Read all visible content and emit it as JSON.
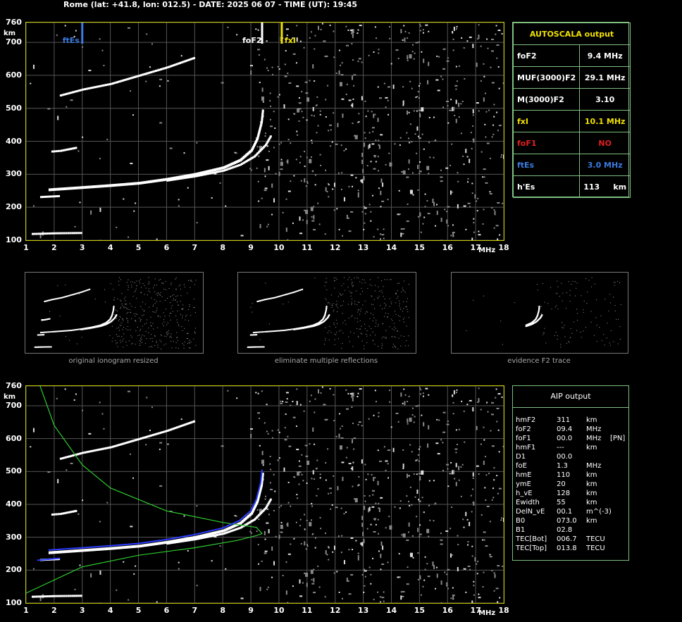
{
  "header": {
    "title": "Rome (lat: +41.8, lon: 012.5) - DATE: 2025 06 07 - TIME (UT): 19:45"
  },
  "axes": {
    "y_unit": "km",
    "x_unit": "MHz",
    "y_ticks": [
      "760",
      "700",
      "600",
      "500",
      "400",
      "300",
      "200",
      "100"
    ],
    "x_ticks": [
      "1",
      "2",
      "3",
      "4",
      "5",
      "6",
      "7",
      "8",
      "9",
      "10",
      "11",
      "12",
      "13",
      "14",
      "15",
      "16",
      "17",
      "18"
    ],
    "xlim": [
      1,
      18
    ],
    "ylim": [
      100,
      760
    ]
  },
  "markers": [
    {
      "label": "ftEs",
      "freq": 3.0,
      "color": "#3b7be0"
    },
    {
      "label": "foF2",
      "freq": 9.4,
      "color": "#ffffff"
    },
    {
      "label": "fxI",
      "freq": 10.1,
      "color": "#f0e000"
    }
  ],
  "autoscala": {
    "title": "AUTOSCALA output",
    "rows": [
      {
        "name": "foF2",
        "value": "9.4 MHz",
        "color": "#ffffff"
      },
      {
        "name": "MUF(3000)F2",
        "value": "29.1 MHz",
        "color": "#ffffff"
      },
      {
        "name": "M(3000)F2",
        "value": "3.10",
        "color": "#ffffff"
      },
      {
        "name": "fxI",
        "value": "10.1 MHz",
        "color": "#f0e000"
      },
      {
        "name": "foF1",
        "value": "NO",
        "color": "#e02020"
      },
      {
        "name": "ftEs",
        "value": "3.0 MHz",
        "color": "#3b7be0"
      },
      {
        "name": "h'Es",
        "value": "113     km",
        "color": "#ffffff"
      }
    ]
  },
  "thumbnails": [
    {
      "caption": "original ionogram resized"
    },
    {
      "caption": "eliminate multiple reflections"
    },
    {
      "caption": "evidence F2 trace"
    }
  ],
  "aip": {
    "title": "AIP output",
    "rows": [
      {
        "name": "hmF2",
        "value": "311",
        "unit": "km",
        "extra": ""
      },
      {
        "name": "foF2",
        "value": "09.4",
        "unit": "MHz",
        "extra": ""
      },
      {
        "name": "foF1",
        "value": "00.0",
        "unit": "MHz",
        "extra": "[PN]"
      },
      {
        "name": "hmF1",
        "value": "---",
        "unit": "km",
        "extra": ""
      },
      {
        "name": "D1",
        "value": "00.0",
        "unit": "",
        "extra": ""
      },
      {
        "name": "foE",
        "value": "1.3",
        "unit": "MHz",
        "extra": ""
      },
      {
        "name": "hmE",
        "value": "110",
        "unit": "km",
        "extra": ""
      },
      {
        "name": "ymE",
        "value": "20",
        "unit": "km",
        "extra": ""
      },
      {
        "name": "h_vE",
        "value": "128",
        "unit": "km",
        "extra": ""
      },
      {
        "name": "Ewidth",
        "value": "55",
        "unit": "km",
        "extra": ""
      },
      {
        "name": "DelN_vE",
        "value": "00.1",
        "unit": "m^(-3)",
        "extra": ""
      },
      {
        "name": "B0",
        "value": "073.0",
        "unit": "km",
        "extra": ""
      },
      {
        "name": "B1",
        "value": "02.8",
        "unit": "",
        "extra": ""
      },
      {
        "name": "TEC[Bot]",
        "value": "006.7",
        "unit": "TECU",
        "extra": ""
      },
      {
        "name": "TEC[Top]",
        "value": "013.8",
        "unit": "TECU",
        "extra": ""
      }
    ]
  },
  "chart_data": {
    "type": "scatter",
    "xlim": [
      1,
      18
    ],
    "ylim": [
      100,
      760
    ],
    "grid": true,
    "series": [
      {
        "values": [
          [
            1.2,
            120
          ],
          [
            2.0,
            122
          ],
          [
            3.0,
            123
          ]
        ]
      },
      {
        "values": [
          [
            1.5,
            232
          ],
          [
            2.2,
            235
          ]
        ]
      },
      {
        "values": [
          [
            1.8,
            255
          ],
          [
            3,
            262
          ],
          [
            4,
            268
          ],
          [
            5,
            275
          ],
          [
            6,
            287
          ],
          [
            7,
            302
          ],
          [
            8,
            322
          ],
          [
            8.6,
            345
          ],
          [
            9.0,
            375
          ],
          [
            9.2,
            410
          ],
          [
            9.35,
            460
          ],
          [
            9.4,
            500
          ]
        ]
      },
      {
        "values": [
          [
            6,
            282
          ],
          [
            7,
            295
          ],
          [
            8,
            312
          ],
          [
            8.6,
            330
          ],
          [
            9.1,
            355
          ],
          [
            9.5,
            390
          ],
          [
            9.7,
            420
          ]
        ]
      },
      {
        "values": [
          [
            2.2,
            540
          ],
          [
            3,
            558
          ],
          [
            4,
            575
          ],
          [
            5,
            600
          ],
          [
            6,
            625
          ],
          [
            7,
            655
          ]
        ]
      },
      {
        "values": [
          [
            1.9,
            370
          ],
          [
            2.2,
            372
          ],
          [
            2.8,
            382
          ]
        ]
      }
    ],
    "aip_profile": [
      [
        1.0,
        130
      ],
      [
        3.0,
        210
      ],
      [
        5.0,
        245
      ],
      [
        7.0,
        268
      ],
      [
        8.5,
        290
      ],
      [
        9.2,
        305
      ],
      [
        9.4,
        311
      ],
      [
        9.2,
        330
      ],
      [
        8.0,
        345
      ],
      [
        6.0,
        380
      ],
      [
        4.0,
        450
      ],
      [
        3.0,
        520
      ],
      [
        2.0,
        640
      ],
      [
        1.5,
        760
      ]
    ]
  }
}
